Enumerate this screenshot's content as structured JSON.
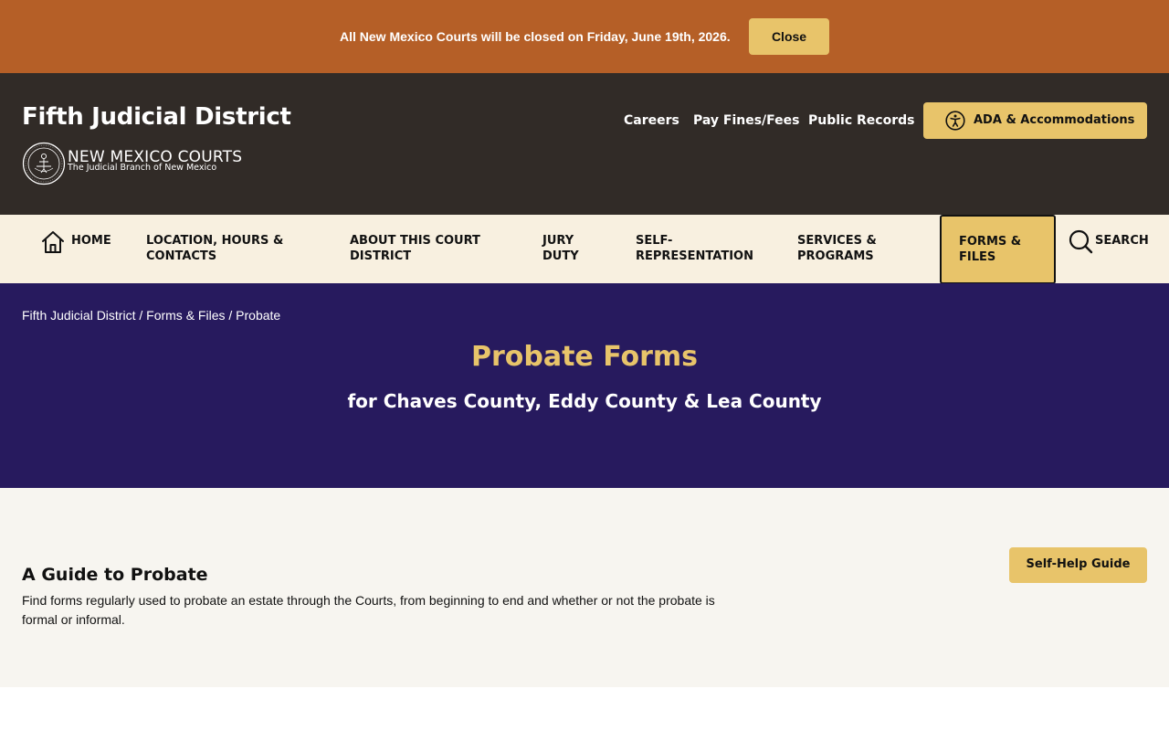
{
  "alert": {
    "message": "All New Mexico Courts will be closed on Friday, June 19th, 2026.",
    "close_label": "Close"
  },
  "header": {
    "site_title": "Fifth Judicial District",
    "logo_name": "NEW MEXICO COURTS",
    "logo_tagline": "The Judicial Branch of New Mexico",
    "utility_links": [
      "Careers",
      "Pay Fines/Fees",
      "Public Records"
    ],
    "ada_label": "ADA & Accommodations"
  },
  "nav": {
    "home": "HOME",
    "items": [
      "LOCATION, HOURS & CONTACTS",
      "ABOUT THIS COURT DISTRICT",
      "JURY DUTY",
      "SELF-REPRESENTATION",
      "SERVICES & PROGRAMS",
      "FORMS & FILES"
    ],
    "active_index": 5,
    "search": "SEARCH"
  },
  "hero": {
    "breadcrumb": [
      "Fifth Judicial District",
      "Forms & Files",
      "Probate"
    ],
    "breadcrumb_separator": " / ",
    "title": "Probate Forms",
    "subtitle": "for Chaves County, Eddy County & Lea County"
  },
  "content": {
    "guide_title": "A Guide to Probate",
    "guide_description": "Find forms regularly used to probate an estate through the Courts, from beginning to end and whether or not the probate is formal or informal.",
    "self_help_label": "Self-Help Guide"
  },
  "colors": {
    "alert_bg": "#b55f27",
    "header_bg": "#312b27",
    "accent_gold": "#e8c46a",
    "nav_bg": "#f8f0e0",
    "hero_bg": "#271a5e",
    "content_bg": "#f7f5f0"
  },
  "icons": {
    "seal": "court-seal-icon",
    "ada": "accessibility-icon",
    "home": "home-icon",
    "search": "search-icon"
  }
}
